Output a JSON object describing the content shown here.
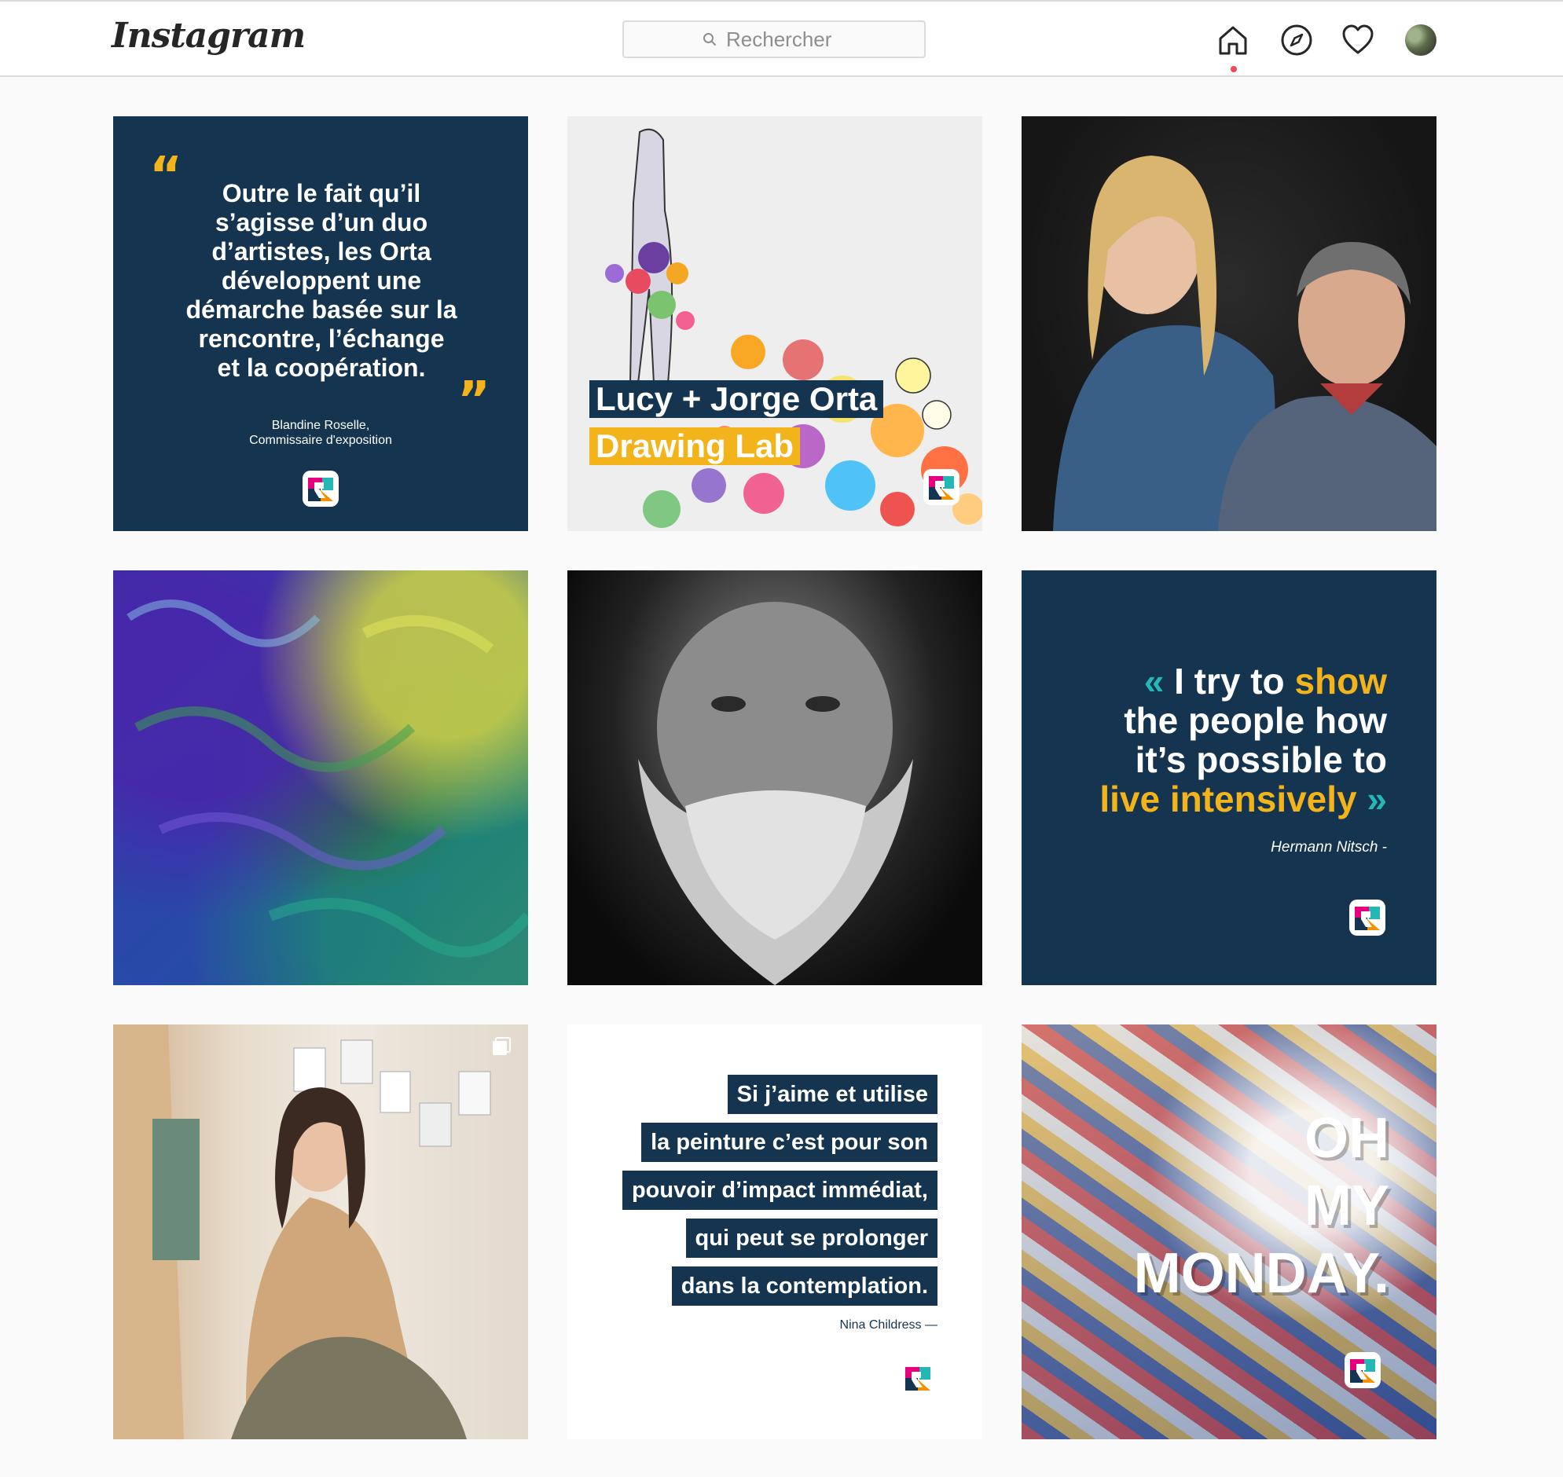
{
  "app": {
    "logo": "Instagram"
  },
  "search": {
    "placeholder": "Rechercher"
  },
  "nav": {
    "icons": [
      "home-icon",
      "explore-icon",
      "heart-icon",
      "profile-avatar"
    ]
  },
  "colors": {
    "navy": "#14344f",
    "yellow": "#f2b31b",
    "teal": "#27b6b6",
    "notification": "#ed4956",
    "brand_pink": "#e6007e",
    "brand_teal": "#27b6b6",
    "brand_orange": "#f39200"
  },
  "posts": {
    "p1": {
      "quote": "Outre le fait qu’il\ns’agisse d’un duo\nd’artistes, les Orta\ndéveloppent une\ndémarche basée sur la\nrencontre, l’échange\net la coopération.",
      "author": "Blandine Roselle,\nCommissaire d'exposition"
    },
    "p2": {
      "line1": "Lucy + Jorge Orta",
      "line2": "Drawing Lab"
    },
    "p6": {
      "open": "«",
      "w1": " I try to ",
      "w2": "show",
      "line2": "the people how",
      "line3": "it’s possible to",
      "w4": "live intensively",
      "close": " »",
      "author": "Hermann Nitsch -"
    },
    "p8": {
      "lines": [
        "Si j’aime et utilise",
        "la peinture c’est pour son",
        "pouvoir d’impact immédiat,",
        "qui peut se prolonger",
        "dans la contemplation."
      ],
      "author": "Nina Childress —"
    },
    "p9": {
      "text": "OH\nMY\nMONDAY."
    }
  }
}
